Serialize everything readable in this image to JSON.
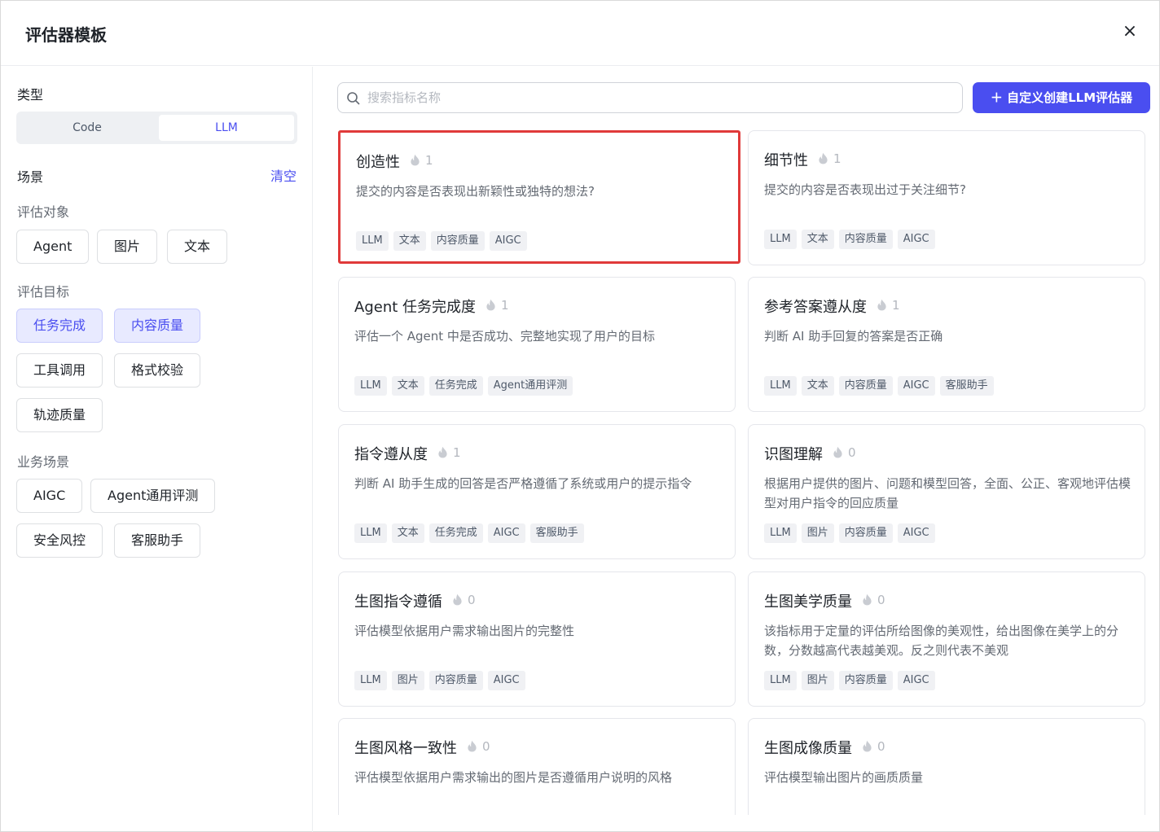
{
  "modal": {
    "title": "评估器模板",
    "close_label": "×"
  },
  "sidebar": {
    "type_label": "类型",
    "type_options": [
      "Code",
      "LLM"
    ],
    "scene_label": "场景",
    "clear_label": "清空",
    "eval_object_label": "评估对象",
    "eval_object_chips": [
      "Agent",
      "图片",
      "文本"
    ],
    "eval_goal_label": "评估目标",
    "eval_goal_chips": [
      "任务完成",
      "内容质量",
      "工具调用",
      "格式校验",
      "轨迹质量"
    ],
    "business_label": "业务场景",
    "business_chips": [
      "AIGC",
      "Agent通用评测",
      "安全风控",
      "客服助手"
    ]
  },
  "search": {
    "placeholder": "搜索指标名称",
    "value": ""
  },
  "create_button": {
    "label": "自定义创建LLM评估器"
  },
  "cards": [
    {
      "title": "创造性",
      "count": "1",
      "desc": "提交的内容是否表现出新颖性或独特的想法?",
      "tags": [
        "LLM",
        "文本",
        "内容质量",
        "AIGC"
      ]
    },
    {
      "title": "细节性",
      "count": "1",
      "desc": "提交的内容是否表现出过于关注细节?",
      "tags": [
        "LLM",
        "文本",
        "内容质量",
        "AIGC"
      ]
    },
    {
      "title": "Agent 任务完成度",
      "count": "1",
      "desc": "评估一个 Agent 中是否成功、完整地实现了用户的目标",
      "tags": [
        "LLM",
        "文本",
        "任务完成",
        "Agent通用评测"
      ]
    },
    {
      "title": "参考答案遵从度",
      "count": "1",
      "desc": "判断 AI 助手回复的答案是否正确",
      "tags": [
        "LLM",
        "文本",
        "内容质量",
        "AIGC",
        "客服助手"
      ]
    },
    {
      "title": "指令遵从度",
      "count": "1",
      "desc": "判断 AI 助手生成的回答是否严格遵循了系统或用户的提示指令",
      "tags": [
        "LLM",
        "文本",
        "任务完成",
        "AIGC",
        "客服助手"
      ]
    },
    {
      "title": "识图理解",
      "count": "0",
      "desc": "根据用户提供的图片、问题和模型回答，全面、公正、客观地评估模型对用户指令的回应质量",
      "tags": [
        "LLM",
        "图片",
        "内容质量",
        "AIGC"
      ]
    },
    {
      "title": "生图指令遵循",
      "count": "0",
      "desc": "评估模型依据用户需求输出图片的完整性",
      "tags": [
        "LLM",
        "图片",
        "内容质量",
        "AIGC"
      ]
    },
    {
      "title": "生图美学质量",
      "count": "0",
      "desc": "该指标用于定量的评估所给图像的美观性，给出图像在美学上的分数，分数越高代表越美观。反之则代表不美观",
      "tags": [
        "LLM",
        "图片",
        "内容质量",
        "AIGC"
      ]
    },
    {
      "title": "生图风格一致性",
      "count": "0",
      "desc": "评估模型依据用户需求输出的图片是否遵循用户说明的风格",
      "tags": []
    },
    {
      "title": "生图成像质量",
      "count": "0",
      "desc": "评估模型输出图片的画质质量",
      "tags": []
    }
  ]
}
